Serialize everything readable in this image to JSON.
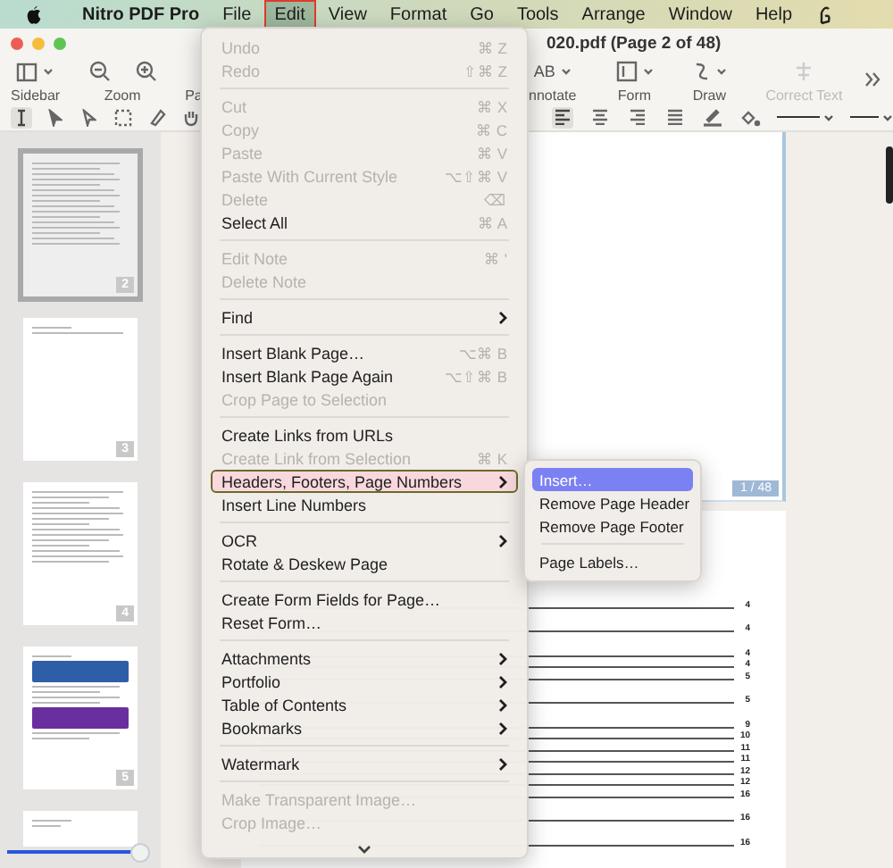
{
  "menu_bar": {
    "items": [
      {
        "label": "Nitro PDF Pro",
        "kind": "app",
        "selected": false
      },
      {
        "label": "File",
        "kind": "menu",
        "selected": false
      },
      {
        "label": "Edit",
        "kind": "menu",
        "selected": true
      },
      {
        "label": "View",
        "kind": "menu",
        "selected": false
      },
      {
        "label": "Format",
        "kind": "menu",
        "selected": false
      },
      {
        "label": "Go",
        "kind": "menu",
        "selected": false
      },
      {
        "label": "Tools",
        "kind": "menu",
        "selected": false
      },
      {
        "label": "Arrange",
        "kind": "menu",
        "selected": false
      },
      {
        "label": "Window",
        "kind": "menu",
        "selected": false
      },
      {
        "label": "Help",
        "kind": "menu",
        "selected": false
      }
    ]
  },
  "window": {
    "title": "020.pdf (Page 2 of 48)"
  },
  "toolbar": {
    "left": [
      {
        "kind": "sidebar",
        "label": "Sidebar",
        "disabled": false
      },
      {
        "kind": "zoom",
        "label": "Zoom",
        "disabled": false
      },
      {
        "kind": "plain",
        "label": "Pa",
        "disabled": false
      }
    ],
    "right": [
      {
        "kind": "annotate",
        "label": "nnotate",
        "icon_text": "AB",
        "disabled": false
      },
      {
        "kind": "form",
        "label": "Form",
        "disabled": false
      },
      {
        "kind": "draw",
        "label": "Draw",
        "disabled": false
      },
      {
        "kind": "correct",
        "label": "Correct Text",
        "disabled": true
      }
    ]
  },
  "tools": {
    "left": [
      {
        "kind": "text-cursor",
        "selected": true
      },
      {
        "kind": "arrow",
        "selected": false
      },
      {
        "kind": "hollow-arrow",
        "selected": false
      },
      {
        "kind": "marquee",
        "selected": false
      },
      {
        "kind": "eraser",
        "selected": false
      },
      {
        "kind": "hand",
        "selected": false
      }
    ],
    "right": [
      {
        "kind": "align-left",
        "selected": true
      },
      {
        "kind": "align-center",
        "selected": false
      },
      {
        "kind": "align-right",
        "selected": false
      },
      {
        "kind": "justify",
        "selected": false
      },
      {
        "kind": "pen",
        "selected": false
      },
      {
        "kind": "fill",
        "selected": false
      },
      {
        "kind": "line-style",
        "selected": false
      },
      {
        "kind": "line-end",
        "selected": false
      }
    ]
  },
  "sidebar": {
    "thumbnails": [
      {
        "kind": "toc",
        "page": "2",
        "selected": true
      },
      {
        "kind": "blank",
        "page": "3",
        "selected": false
      },
      {
        "kind": "text",
        "page": "4",
        "selected": false
      },
      {
        "kind": "banners",
        "page": "5",
        "selected": false
      },
      {
        "kind": "partial",
        "selected": false
      }
    ],
    "slider": {
      "level": 0.93
    }
  },
  "document": {
    "page_badge": "1 / 48",
    "toc_groups": [
      [
        "4"
      ],
      [
        "4"
      ],
      [
        "4",
        "4",
        "5"
      ],
      [
        "5"
      ],
      [
        "9",
        "10",
        "11",
        "11",
        "12",
        "12",
        "16"
      ],
      [
        "16"
      ],
      [
        "16"
      ]
    ]
  },
  "edit_menu": {
    "items": [
      {
        "kind": "item",
        "label": "Undo",
        "shortcut": "⌘ Z",
        "disabled": true,
        "submenu": false,
        "selected": false
      },
      {
        "kind": "item",
        "label": "Redo",
        "shortcut": "⇧⌘ Z",
        "disabled": true,
        "submenu": false,
        "selected": false
      },
      {
        "kind": "separator"
      },
      {
        "kind": "item",
        "label": "Cut",
        "shortcut": "⌘ X",
        "disabled": true,
        "submenu": false,
        "selected": false
      },
      {
        "kind": "item",
        "label": "Copy",
        "shortcut": "⌘ C",
        "disabled": true,
        "submenu": false,
        "selected": false
      },
      {
        "kind": "item",
        "label": "Paste",
        "shortcut": "⌘ V",
        "disabled": true,
        "submenu": false,
        "selected": false
      },
      {
        "kind": "item",
        "label": "Paste With Current Style",
        "shortcut": "⌥⇧⌘ V",
        "disabled": true,
        "submenu": false,
        "selected": false
      },
      {
        "kind": "item",
        "label": "Delete",
        "shortcut": "⌫",
        "disabled": true,
        "submenu": false,
        "selected": false
      },
      {
        "kind": "item",
        "label": "Select All",
        "shortcut": "⌘ A",
        "disabled": false,
        "submenu": false,
        "selected": false
      },
      {
        "kind": "separator"
      },
      {
        "kind": "item",
        "label": "Edit Note",
        "shortcut": "⌘ '",
        "disabled": true,
        "submenu": false,
        "selected": false
      },
      {
        "kind": "item",
        "label": "Delete Note",
        "disabled": true,
        "submenu": false,
        "selected": false
      },
      {
        "kind": "separator"
      },
      {
        "kind": "item",
        "label": "Find",
        "disabled": false,
        "submenu": true,
        "selected": false
      },
      {
        "kind": "separator"
      },
      {
        "kind": "item",
        "label": "Insert Blank Page…",
        "shortcut": "⌥⌘ B",
        "disabled": false,
        "submenu": false,
        "selected": false
      },
      {
        "kind": "item",
        "label": "Insert Blank Page Again",
        "shortcut": "⌥⇧⌘ B",
        "disabled": false,
        "submenu": false,
        "selected": false
      },
      {
        "kind": "item",
        "label": "Crop Page to Selection",
        "disabled": true,
        "submenu": false,
        "selected": false
      },
      {
        "kind": "separator"
      },
      {
        "kind": "item",
        "label": "Create Links from URLs",
        "disabled": false,
        "submenu": false,
        "selected": false
      },
      {
        "kind": "item",
        "label": "Create Link from Selection",
        "shortcut": "⌘ K",
        "disabled": true,
        "submenu": false,
        "selected": false
      },
      {
        "kind": "item",
        "label": "Headers, Footers, Page Numbers",
        "disabled": false,
        "submenu": true,
        "selected": true
      },
      {
        "kind": "item",
        "label": "Insert Line Numbers",
        "disabled": false,
        "submenu": false,
        "selected": false
      },
      {
        "kind": "separator"
      },
      {
        "kind": "item",
        "label": "OCR",
        "disabled": false,
        "submenu": true,
        "selected": false
      },
      {
        "kind": "item",
        "label": "Rotate & Deskew Page",
        "disabled": false,
        "submenu": false,
        "selected": false
      },
      {
        "kind": "separator"
      },
      {
        "kind": "item",
        "label": "Create Form Fields for Page…",
        "disabled": false,
        "submenu": false,
        "selected": false
      },
      {
        "kind": "item",
        "label": "Reset Form…",
        "disabled": false,
        "submenu": false,
        "selected": false
      },
      {
        "kind": "separator"
      },
      {
        "kind": "item",
        "label": "Attachments",
        "disabled": false,
        "submenu": true,
        "selected": false
      },
      {
        "kind": "item",
        "label": "Portfolio",
        "disabled": false,
        "submenu": true,
        "selected": false
      },
      {
        "kind": "item",
        "label": "Table of Contents",
        "disabled": false,
        "submenu": true,
        "selected": false
      },
      {
        "kind": "item",
        "label": "Bookmarks",
        "disabled": false,
        "submenu": true,
        "selected": false
      },
      {
        "kind": "separator"
      },
      {
        "kind": "item",
        "label": "Watermark",
        "disabled": false,
        "submenu": true,
        "selected": false
      },
      {
        "kind": "separator"
      },
      {
        "kind": "item",
        "label": "Make Transparent Image…",
        "disabled": true,
        "submenu": false,
        "selected": false
      },
      {
        "kind": "item",
        "label": "Crop Image…",
        "disabled": true,
        "submenu": false,
        "selected": false
      }
    ]
  },
  "submenu": {
    "items": [
      {
        "kind": "item",
        "label": "Insert…",
        "selected": true
      },
      {
        "kind": "item",
        "label": "Remove Page Header",
        "selected": false
      },
      {
        "kind": "item",
        "label": "Remove Page Footer",
        "selected": false
      },
      {
        "kind": "separator"
      },
      {
        "kind": "item",
        "label": "Page Labels…",
        "selected": false
      }
    ]
  }
}
